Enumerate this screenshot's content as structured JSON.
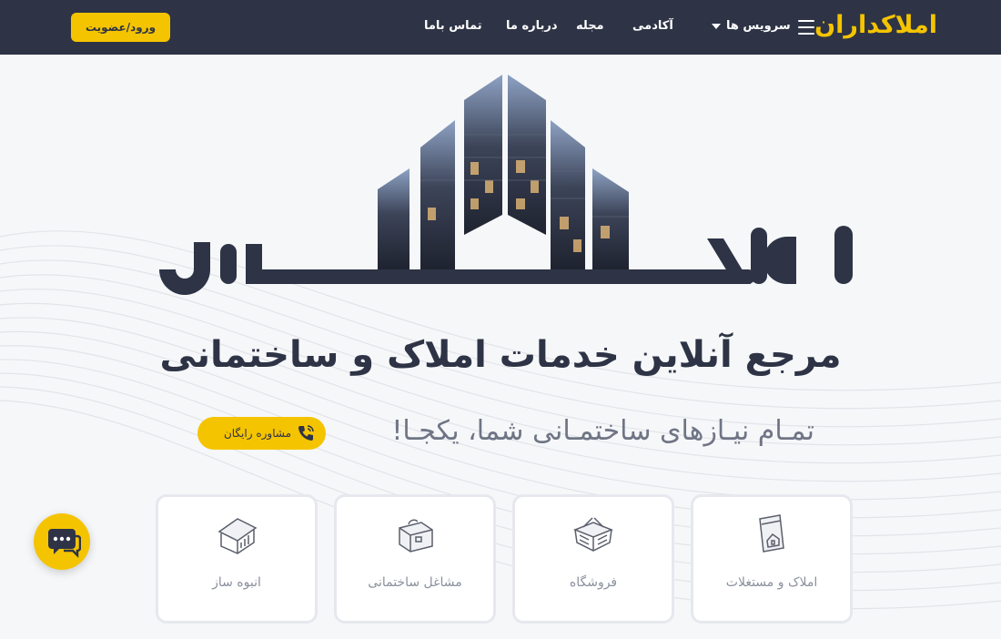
{
  "nav": {
    "logo": "املاکداران",
    "services": "سرویس ها",
    "academy": "آکادمی",
    "magazine": "مجله",
    "about": "درباره ما",
    "contact": "تماس باما",
    "login": "ورود/عضویت"
  },
  "hero": {
    "logo_text": "املاکداران",
    "headline": "مرجع آنلاین خدمات املاک و ساختمانی",
    "subline": "تمـام نیـازهای ساختمـانی شما، یکجـا!",
    "consult": "مشاوره رایگان"
  },
  "cards": [
    {
      "label": "املاک و مستغلات",
      "icon": "real-estate-icon"
    },
    {
      "label": "فروشگاه",
      "icon": "shop-basket-icon"
    },
    {
      "label": "مشاغل ساختمانی",
      "icon": "toolbox-icon"
    },
    {
      "label": "انبوه ساز",
      "icon": "building-chart-icon"
    }
  ],
  "colors": {
    "nav_bg": "#2e3446",
    "accent": "#f5c400",
    "text_dark": "#2e3446",
    "text_muted": "#8b909d"
  }
}
